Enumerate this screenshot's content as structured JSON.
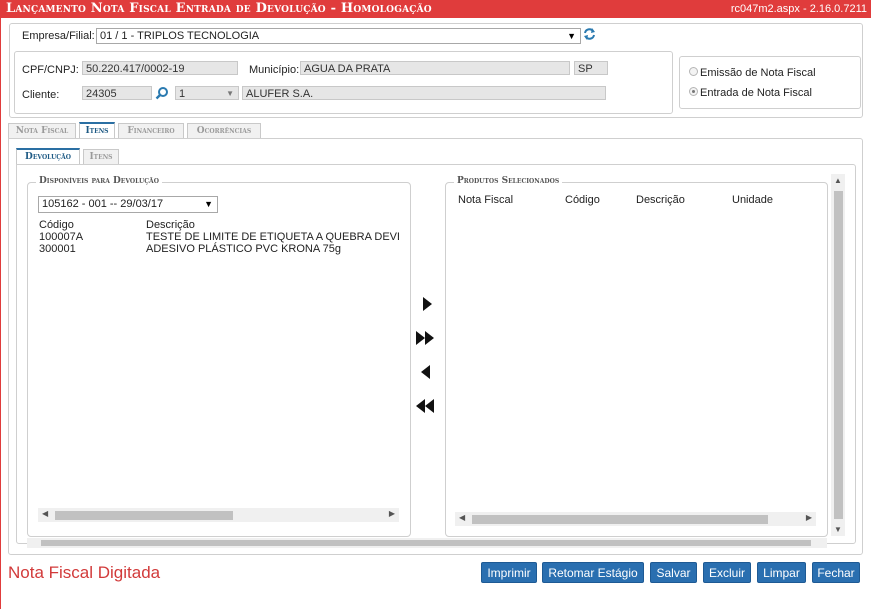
{
  "window": {
    "title": "Lançamento Nota Fiscal Entrada de Devolução  - Homologação",
    "version": "rc047m2.aspx - 2.16.0.7211"
  },
  "header": {
    "empresa_label": "Empresa/Filial:",
    "empresa_value": "01 / 1 - TRIPLOS TECNOLOGIA",
    "cpf_label": "CPF/CNPJ:",
    "cpf_value": "50.220.417/0002-19",
    "municipio_label": "Município:",
    "municipio_value": "AGUA DA PRATA",
    "uf_value": "SP",
    "cliente_label": "Cliente:",
    "cliente_code": "24305",
    "cliente_seq": "1",
    "cliente_name": "ALUFER S.A."
  },
  "options": {
    "emissao": "Emissão de Nota Fiscal",
    "entrada": "Entrada de Nota Fiscal",
    "selected": "entrada"
  },
  "tabs": [
    "Nota Fiscal",
    "Itens",
    "Financeiro",
    "Ocorrências"
  ],
  "active_tab": "Itens",
  "subtabs": [
    "Devolução",
    "Itens"
  ],
  "active_subtab": "Devolução",
  "disponiveis": {
    "legend": "Disponíveis para Devolução",
    "selected_nf": "105162 - 001 -- 29/03/17",
    "columns": [
      "Código",
      "Descrição"
    ],
    "rows": [
      {
        "codigo": "100007A",
        "descricao": "TESTE DE LIMITE DE ETIQUETA A QUEBRA DEVE ACONTECER"
      },
      {
        "codigo": "300001",
        "descricao": "ADESIVO PLÁSTICO PVC KRONA 75g"
      }
    ]
  },
  "selecionados": {
    "legend": "Produtos Selecionados",
    "columns": [
      "Nota Fiscal",
      "Código",
      "Descrição",
      "Unidade"
    ]
  },
  "transfer_buttons": [
    "move-right",
    "move-all-right",
    "move-left",
    "move-all-left"
  ],
  "footer": {
    "status": "Nota Fiscal Digitada",
    "buttons": [
      "Imprimir",
      "Retomar Estágio",
      "Salvar",
      "Excluir",
      "Limpar",
      "Fechar"
    ]
  },
  "colors": {
    "titlebar": "#e03c3c",
    "button": "#2a6fb0",
    "status": "#d23a3a",
    "tab_active": "#1e5a84",
    "search_icon": "#2a7ab0"
  }
}
